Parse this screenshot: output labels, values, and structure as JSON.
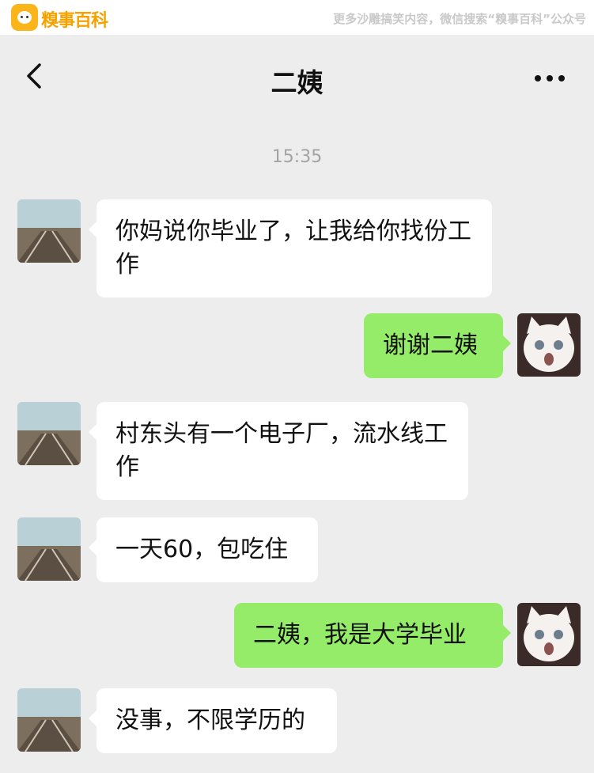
{
  "watermark": {
    "logo_text": "糗事百科",
    "slogan": "更多沙雕搞笑内容，微信搜索“糗事百科”公众号"
  },
  "nav": {
    "title": "二姨",
    "back_icon": "chevron-left-icon",
    "more_icon": "more-dots-icon"
  },
  "chat": {
    "timestamp": "15:35",
    "messages": [
      {
        "side": "left",
        "text": "你妈说你毕业了，让我给你找份工作"
      },
      {
        "side": "right",
        "text": "谢谢二姨"
      },
      {
        "side": "left",
        "text": "村东头有一个电子厂，流水线工作"
      },
      {
        "side": "left",
        "text": "一天60，包吃住"
      },
      {
        "side": "right",
        "text": "二姨，我是大学毕业"
      },
      {
        "side": "left",
        "text": "没事，不限学历的"
      }
    ]
  },
  "colors": {
    "background": "#ededed",
    "incoming_bubble": "#ffffff",
    "outgoing_bubble": "#95ec69"
  }
}
